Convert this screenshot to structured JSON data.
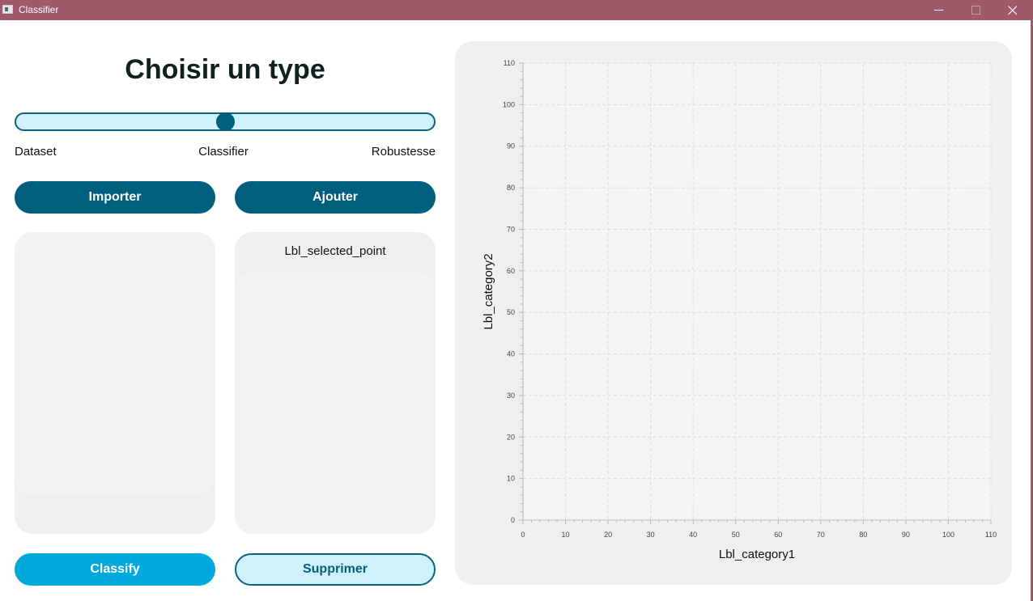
{
  "window": {
    "title": "Classifier",
    "controls": {
      "minimize": "minimize-icon",
      "maximize": "maximize-icon",
      "close": "close-icon"
    }
  },
  "header": {
    "title": "Choisir un type"
  },
  "slider": {
    "value_fraction": 0.5,
    "labels": [
      "Dataset",
      "Classifier",
      "Robustesse"
    ]
  },
  "buttons": {
    "import": "Importer",
    "add": "Ajouter",
    "classify": "Classify",
    "delete": "Supprimer"
  },
  "details_panel": {
    "label": "Lbl_selected_point"
  },
  "colors": {
    "titlebar": "#9e5a68",
    "primary_dark": "#005f7c",
    "primary_light": "#00a9dc",
    "slider_fill": "#cef1fb",
    "panel_bg": "#efefef"
  },
  "chart_data": {
    "type": "scatter",
    "title": "",
    "xlabel": "Lbl_category1",
    "ylabel": "Lbl_category2",
    "xlim": [
      0,
      110
    ],
    "ylim": [
      0,
      110
    ],
    "x_ticks": [
      0,
      10,
      20,
      30,
      40,
      50,
      60,
      70,
      80,
      90,
      100,
      110
    ],
    "y_ticks": [
      0,
      10,
      20,
      30,
      40,
      50,
      60,
      70,
      80,
      90,
      100,
      110
    ],
    "grid": true,
    "series": []
  }
}
